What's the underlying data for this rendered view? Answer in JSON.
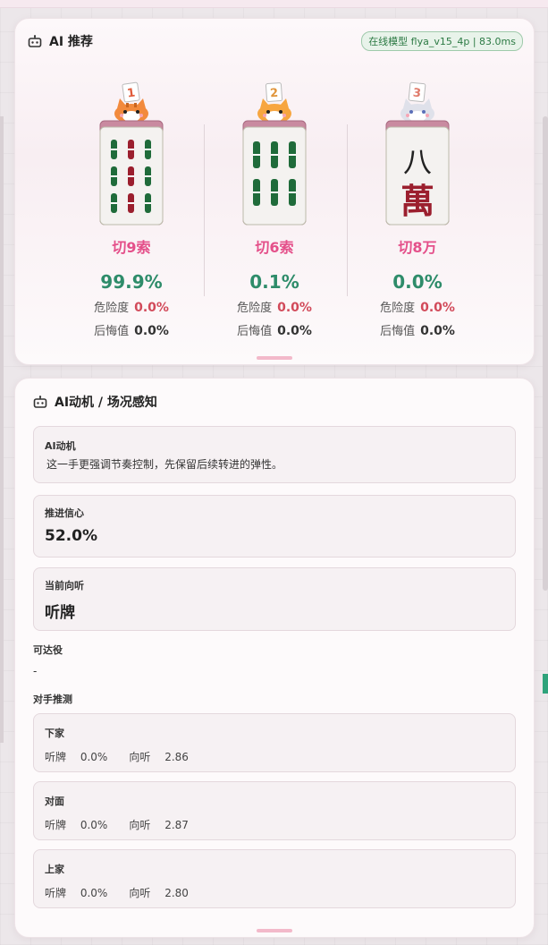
{
  "recommend": {
    "title": "AI 推荐",
    "model_badge": "在线模型 flya_v15_4p | 83.0ms",
    "risk_label": "危险度",
    "regret_label": "后悔值",
    "options": [
      {
        "rank": "1",
        "cut": "切9索",
        "prob": "99.9%",
        "risk": "0.0%",
        "regret": "0.0%",
        "tile": "9-sou",
        "cat": "orange-cat-icon"
      },
      {
        "rank": "2",
        "cut": "切6索",
        "prob": "0.1%",
        "risk": "0.0%",
        "regret": "0.0%",
        "tile": "6-sou",
        "cat": "orange-cat-icon"
      },
      {
        "rank": "3",
        "cut": "切8万",
        "prob": "0.0%",
        "risk": "0.0%",
        "regret": "0.0%",
        "tile": "8-man",
        "cat": "grey-cat-icon"
      }
    ],
    "tile_man_glyph_top": "八",
    "tile_man_glyph_bottom": "萬"
  },
  "ai": {
    "title": "AI动机 / 场况感知",
    "motive_label": "AI动机",
    "motive_text": "这一手更强调节奏控制，先保留后续转进的弹性。",
    "confidence_label": "推进信心",
    "confidence_value": "52.0%",
    "shanten_label": "当前向听",
    "shanten_value": "听牌",
    "yaku_label": "可达役",
    "yaku_value": "-",
    "opponents_label": "对手推测",
    "tenpai_label": "听牌",
    "shanten_short": "向听",
    "opponents": [
      {
        "seat": "下家",
        "tenpai": "0.0%",
        "shanten": "2.86"
      },
      {
        "seat": "对面",
        "tenpai": "0.0%",
        "shanten": "2.87"
      },
      {
        "seat": "上家",
        "tenpai": "0.0%",
        "shanten": "2.80"
      }
    ]
  },
  "colors": {
    "accent_pink": "#e4508a",
    "prob_green": "#2e8c6a",
    "risk_red": "#d24a5a",
    "badge_green": "#2c7a44"
  }
}
